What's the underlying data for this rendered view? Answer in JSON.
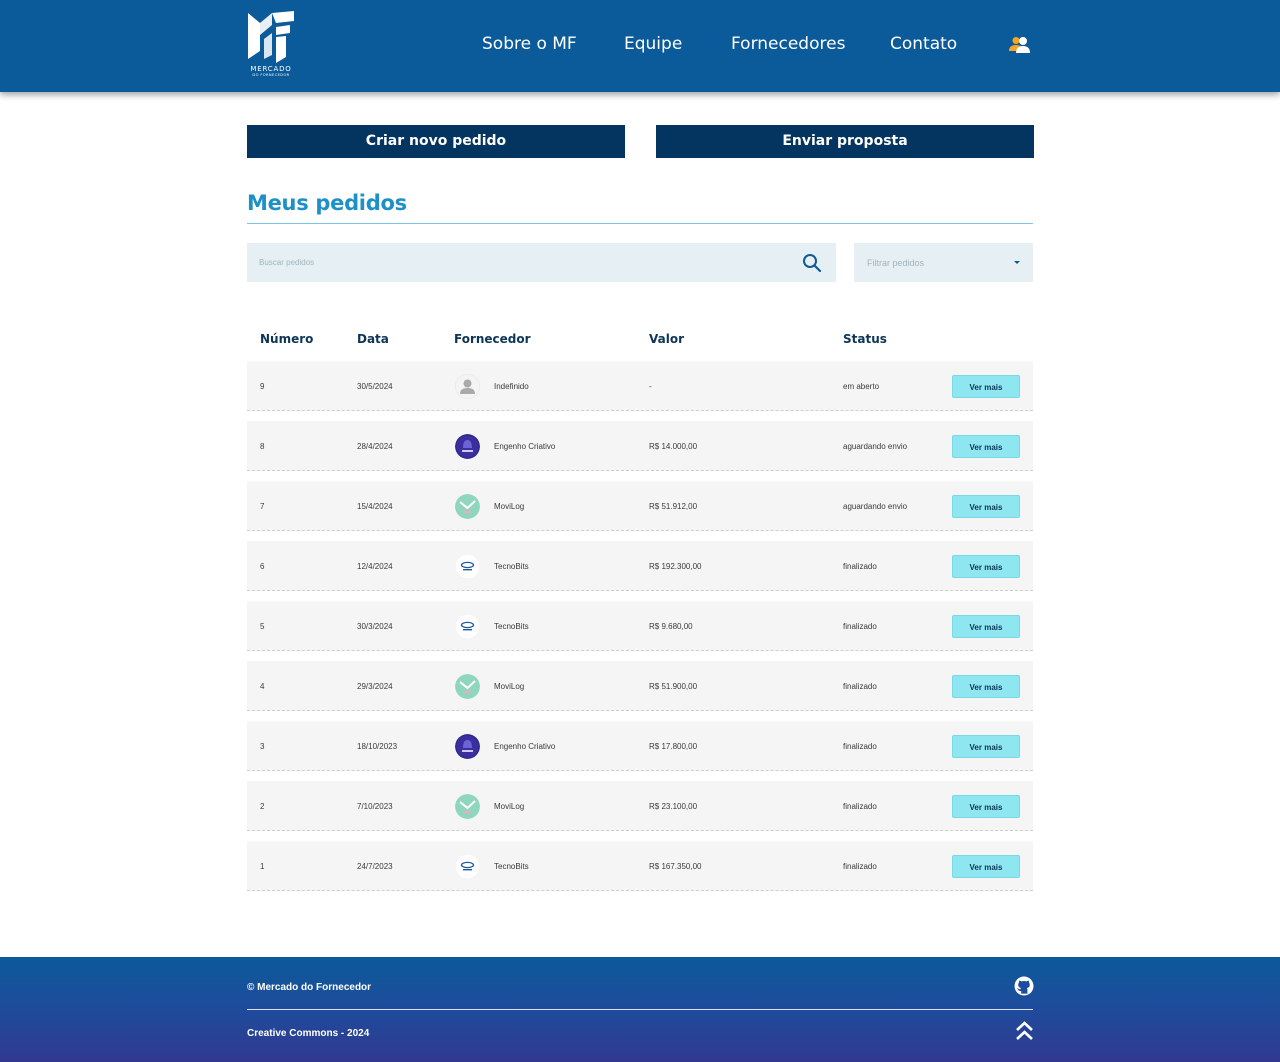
{
  "header": {
    "logo_text": "MERCADO",
    "logo_subtext": "DO FORNECEDOR",
    "nav": [
      "Sobre o MF",
      "Equipe",
      "Fornecedores",
      "Contato"
    ],
    "user_icon": "users-icon"
  },
  "actions": {
    "create_order": "Criar novo pedido",
    "send_proposal": "Enviar proposta"
  },
  "page": {
    "title": "Meus pedidos"
  },
  "search": {
    "placeholder": "Buscar pedidos",
    "icon": "search-icon"
  },
  "filter": {
    "label": "Filtrar pedidos"
  },
  "table": {
    "headers": [
      "Número",
      "Data",
      "Fornecedor",
      "Valor",
      "Status"
    ],
    "button_label": "Ver mais",
    "rows": [
      {
        "numero": "9",
        "data": "30/5/2024",
        "fornecedor": "Indefinido",
        "valor": "-",
        "status": "em aberto",
        "avatar": "default-user-avatar"
      },
      {
        "numero": "8",
        "data": "28/4/2024",
        "fornecedor": "Engenho Criativo",
        "valor": "R$ 14.000,00",
        "status": "aguardando envio",
        "avatar": "engenho-criativo-logo"
      },
      {
        "numero": "7",
        "data": "15/4/2024",
        "fornecedor": "MoviLog",
        "valor": "R$ 51.912,00",
        "status": "aguardando envio",
        "avatar": "movilog-logo"
      },
      {
        "numero": "6",
        "data": "12/4/2024",
        "fornecedor": "TecnoBits",
        "valor": "R$ 192.300,00",
        "status": "finalizado",
        "avatar": "tecnobits-logo"
      },
      {
        "numero": "5",
        "data": "30/3/2024",
        "fornecedor": "TecnoBits",
        "valor": "R$ 9.680,00",
        "status": "finalizado",
        "avatar": "tecnobits-logo"
      },
      {
        "numero": "4",
        "data": "29/3/2024",
        "fornecedor": "MoviLog",
        "valor": "R$ 51.900,00",
        "status": "finalizado",
        "avatar": "movilog-logo"
      },
      {
        "numero": "3",
        "data": "18/10/2023",
        "fornecedor": "Engenho Criativo",
        "valor": "R$ 17.800,00",
        "status": "finalizado",
        "avatar": "engenho-criativo-logo"
      },
      {
        "numero": "2",
        "data": "7/10/2023",
        "fornecedor": "MoviLog",
        "valor": "R$ 23.100,00",
        "status": "finalizado",
        "avatar": "movilog-logo"
      },
      {
        "numero": "1",
        "data": "24/7/2023",
        "fornecedor": "TecnoBits",
        "valor": "R$ 167.350,00",
        "status": "finalizado",
        "avatar": "tecnobits-logo"
      }
    ]
  },
  "footer": {
    "copyright": "© Mercado do Fornecedor",
    "license": "Creative Commons - 2024",
    "github_icon": "github-icon",
    "back_to_top_icon": "double-chevron-up-icon"
  },
  "colors": {
    "header_bg": "#0b5a99",
    "button_dark": "#043460",
    "title_blue": "#1e90c8",
    "ver_mais_bg": "#8ee6f0",
    "footer_gradient_end": "#30398f",
    "user_icon_accent": "#f5a623"
  }
}
